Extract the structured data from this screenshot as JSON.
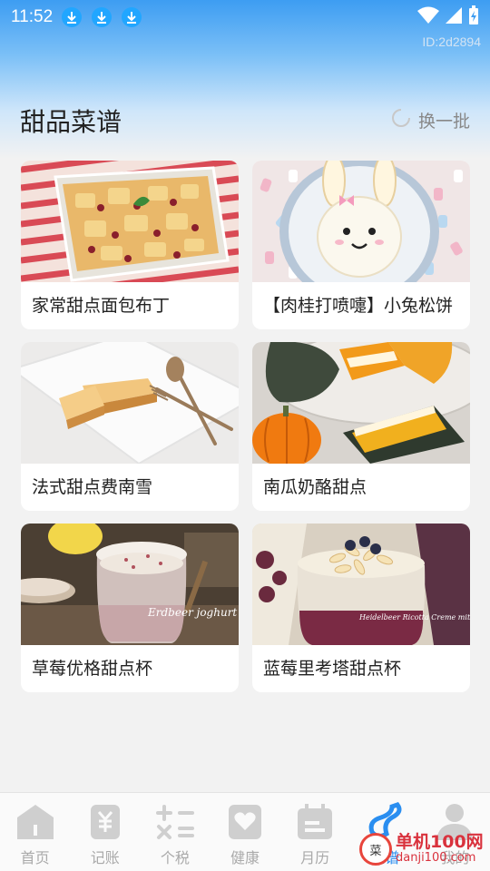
{
  "status_bar": {
    "time": "11:52",
    "notifications": [
      "download-icon",
      "download-icon",
      "download-icon"
    ]
  },
  "device_id": "ID:2d2894",
  "section": {
    "title": "甜品菜谱",
    "refresh_label": "换一批"
  },
  "recipes": [
    {
      "name": "家常甜点面包布丁"
    },
    {
      "name": "【肉桂打喷嚏】小兔松饼"
    },
    {
      "name": "法式甜点费南雪"
    },
    {
      "name": "南瓜奶酪甜点"
    },
    {
      "name": "草莓优格甜点杯",
      "image_caption": "Erdbeer joghurt Creme"
    },
    {
      "name": "蓝莓里考塔甜点杯",
      "image_caption": "Heidelbeer Ricotta Creme mit Mandel Topping von Marion H."
    }
  ],
  "tabbar": {
    "items": [
      {
        "label": "首页",
        "icon": "home-icon"
      },
      {
        "label": "记账",
        "icon": "ledger-icon"
      },
      {
        "label": "个税",
        "icon": "calculator-icon"
      },
      {
        "label": "健康",
        "icon": "heart-icon"
      },
      {
        "label": "月历",
        "icon": "calendar-icon"
      },
      {
        "label": "菜谱",
        "icon": "recipe-icon",
        "active": true
      },
      {
        "label": "我的",
        "icon": "profile-icon"
      }
    ]
  },
  "watermark": {
    "circle_text": "菜",
    "main": "单机100网",
    "sub": "danji100.com"
  },
  "colors": {
    "accent": "#2a8ef0",
    "inactive": "#aaaaaa"
  }
}
